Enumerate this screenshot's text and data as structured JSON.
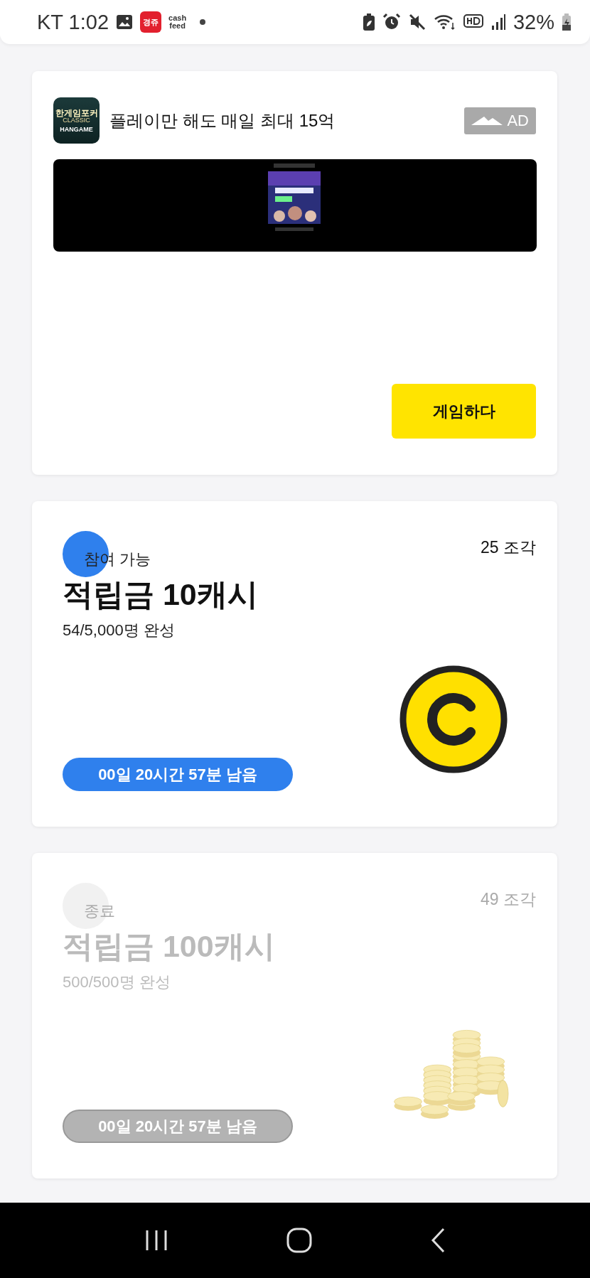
{
  "status_bar": {
    "carrier_time": "KT 1:02",
    "app_badge": "경쥬",
    "app_label_lines": [
      "cash",
      "feed"
    ],
    "battery": "32%"
  },
  "ad": {
    "logo_lines": [
      "한게임포커",
      "CLASSIC",
      "HANGAME"
    ],
    "title": "플레이만 해도 매일 최대 15억",
    "badge": "AD",
    "cta": "게임하다"
  },
  "cards": [
    {
      "kind": "coin",
      "ended": false,
      "status": "참여 가능",
      "pieces": "25 조각",
      "title": "적립금 10캐시",
      "progress": "54/5,000명 완성",
      "timer": "00일 20시간 57분 남음"
    },
    {
      "kind": "coin_stack",
      "ended": true,
      "status": "종료",
      "pieces": "49 조각",
      "title": "적립금 100캐시",
      "progress": "500/500명 완성",
      "timer": "00일 20시간 57분 남음"
    }
  ]
}
